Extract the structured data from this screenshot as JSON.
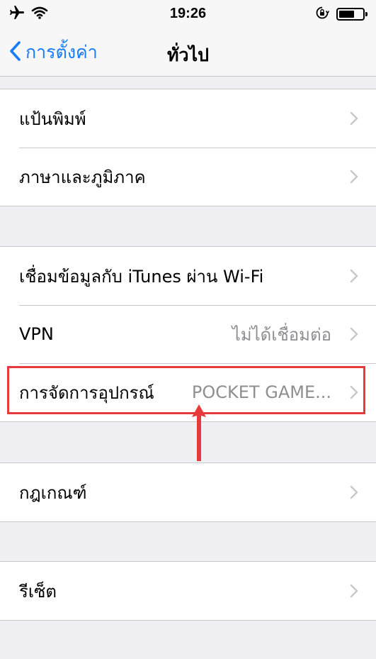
{
  "status_bar": {
    "time": "19:26",
    "icons": [
      "airplane-icon",
      "wifi-icon",
      "orientation-lock-icon",
      "battery-icon"
    ],
    "battery_level": 0.65
  },
  "nav": {
    "back_label": "การตั้งค่า",
    "title": "ทั่วไป"
  },
  "groups": [
    {
      "rows": [
        {
          "label": "แป้นพิมพ์"
        },
        {
          "label": "ภาษาและภูมิภาค"
        }
      ]
    },
    {
      "rows": [
        {
          "label": "เชื่อมข้อมูลกับ iTunes ผ่าน Wi-Fi"
        },
        {
          "label": "VPN",
          "value": "ไม่ได้เชื่อมต่อ"
        },
        {
          "label": "การจัดการอุปกรณ์",
          "value": "POCKET GAME..."
        }
      ]
    },
    {
      "rows": [
        {
          "label": "กฎเกณฑ์"
        }
      ]
    },
    {
      "rows": [
        {
          "label": "รีเซ็ต"
        }
      ]
    }
  ],
  "colors": {
    "accent": "#1a7cf6",
    "annotation": "#e83a3a",
    "background": "#efeff4"
  }
}
